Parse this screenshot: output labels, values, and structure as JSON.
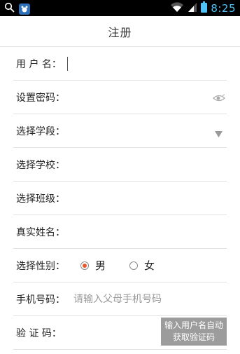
{
  "status_bar": {
    "time": "8:25",
    "icons": [
      "search-icon",
      "app-badge-icon",
      "wifi-icon",
      "signal-icon",
      "battery-icon"
    ]
  },
  "header": {
    "title": "注册"
  },
  "form": {
    "username_label": "用 户 名：",
    "password_label": "设置密码：",
    "grade_label": "选择学段：",
    "school_label": "选择学校：",
    "class_label": "选择班级：",
    "realname_label": "真实姓名：",
    "gender_label": "选择性别：",
    "gender_options": [
      "男",
      "女"
    ],
    "gender_selected": "男",
    "phone_label": "手机号码：",
    "phone_placeholder": "请输入父母手机号码",
    "code_label": "验 证 码：",
    "code_button_line1": "输入用户名自动",
    "code_button_line2": "获取验证码"
  },
  "colors": {
    "status_bar_bg": "#000000",
    "time_color": "#4fc3f7",
    "radio_accent": "#e8572b",
    "code_button_bg": "#9c9c9c",
    "divider": "#e2e2e2"
  }
}
